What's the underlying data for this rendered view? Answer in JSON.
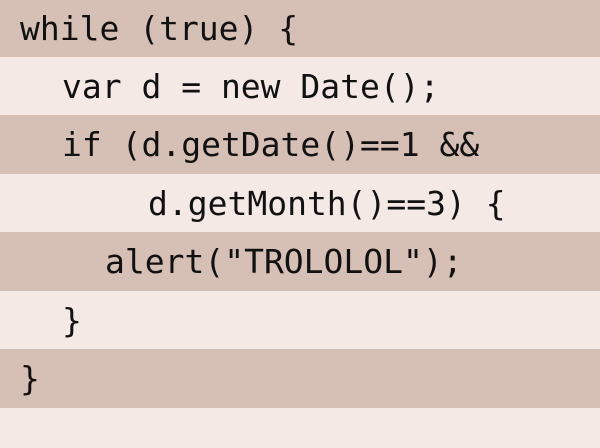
{
  "colors": {
    "stripe_dark": "#d6c0b6",
    "stripe_light": "#f5e9e5",
    "text": "#111111"
  },
  "code": {
    "lines": [
      "while (true) {",
      "var d = new Date();",
      "if (d.getDate()==1 &&",
      "d.getMonth()==3) {",
      "alert(\"TROLOLOL\");",
      "}",
      "}"
    ]
  }
}
